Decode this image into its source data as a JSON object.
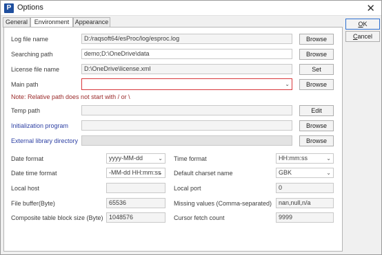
{
  "window": {
    "title": "Options",
    "app_icon_letter": "P",
    "close_glyph": "✕"
  },
  "tabs": [
    {
      "label": "General",
      "active": false
    },
    {
      "label": "Environment",
      "active": true
    },
    {
      "label": "Appearance",
      "active": false
    }
  ],
  "side_buttons": {
    "ok": {
      "accel": "O",
      "rest": "K"
    },
    "cancel": {
      "accel": "C",
      "rest": "ancel"
    }
  },
  "paths": {
    "log_file": {
      "label": "Log file name",
      "value": "D:/raqsoft64/esProc/log/esproc.log",
      "button": "Browse"
    },
    "searching_path": {
      "label": "Searching path",
      "value": "demo;D:\\OneDrive\\data",
      "button": "Browse"
    },
    "license_file": {
      "label": "License file name",
      "value": "D:\\OneDrive\\license.xml",
      "button": "Set"
    },
    "main_path": {
      "label": "Main path",
      "value": "",
      "button": "Browse"
    },
    "note": "Note: Relative path does not start with / or \\",
    "temp_path": {
      "label": "Temp path",
      "value": "",
      "button": "Edit"
    },
    "init_program": {
      "label": "Initialization program",
      "value": "",
      "button": "Browse"
    },
    "ext_lib_dir": {
      "label": "External library directory",
      "value": "",
      "button": "Browse"
    }
  },
  "settings": {
    "date_format": {
      "label": "Date format",
      "value": "yyyy-MM-dd"
    },
    "time_format": {
      "label": "Time format",
      "value": "HH:mm:ss"
    },
    "datetime_format": {
      "label": "Date time format",
      "value": "-MM-dd HH:mm:ss"
    },
    "charset": {
      "label": "Default charset name",
      "value": "GBK"
    },
    "local_host": {
      "label": "Local host",
      "value": ""
    },
    "local_port": {
      "label": "Local port",
      "value": "0"
    },
    "file_buffer": {
      "label": "File buffer(Byte)",
      "value": "65536"
    },
    "missing_values": {
      "label": "Missing values (Comma-separated)",
      "value": "nan,null,n/a"
    },
    "block_size": {
      "label": "Composite table block size (Byte)",
      "value": "1048576"
    },
    "cursor_fetch": {
      "label": "Cursor fetch count",
      "value": "9999"
    }
  },
  "colors": {
    "link": "#2c3fa3",
    "note": "#9a2a2a",
    "highlight_border": "#d8363a",
    "default_button_border": "#2c6fd1"
  },
  "icons": {
    "dropdown": "chevron-down-icon"
  }
}
